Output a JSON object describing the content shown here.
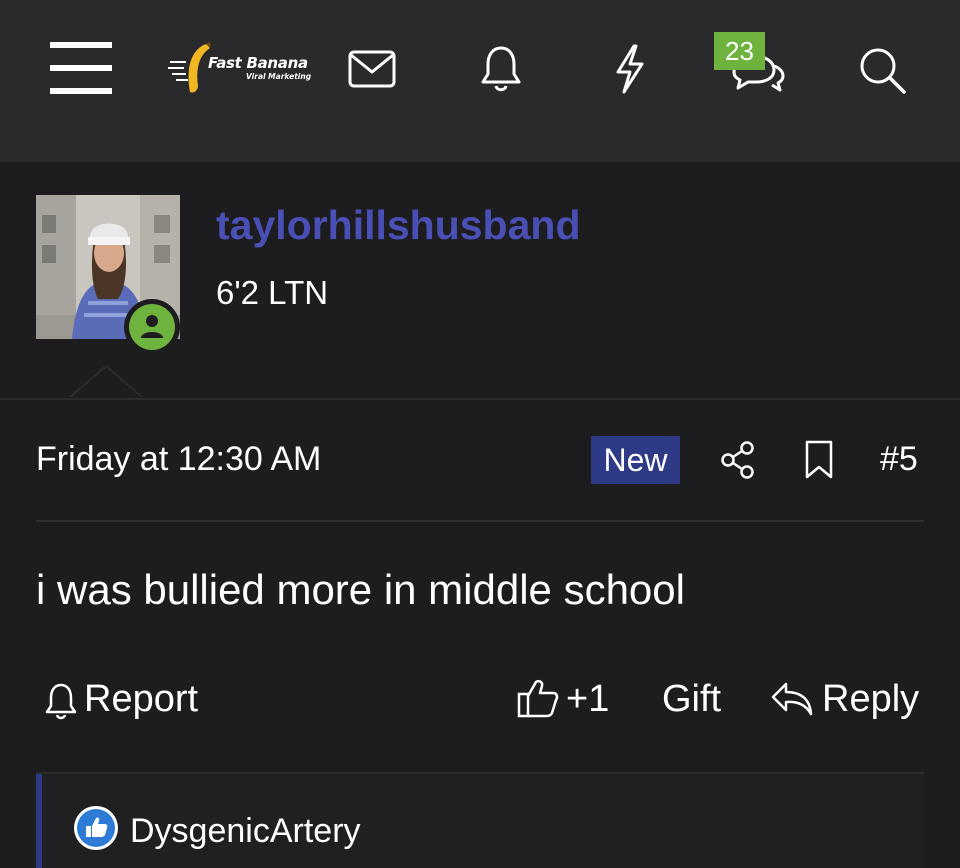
{
  "nav": {
    "logo_title": "Fast Banana",
    "logo_subtitle": "Viral Marketing",
    "conversations_badge": "23",
    "icons": [
      "menu-icon",
      "mail-icon",
      "bell-icon",
      "lightning-icon",
      "chat-bubbles-icon",
      "search-icon"
    ]
  },
  "profile": {
    "username": "taylorhillshusband",
    "user_title": "6'2 LTN",
    "status": "online"
  },
  "post": {
    "date": "Friday at 12:30 AM",
    "new_label": "New",
    "number": "#5",
    "body": "i was bullied more in middle school"
  },
  "actions": {
    "report_label": "Report",
    "like_label": "+1",
    "gift_label": "Gift",
    "reply_label": "Reply"
  },
  "reactions": {
    "user": "DysgenicArtery"
  },
  "colors": {
    "username": "#4a4fb5",
    "new_badge": "#2e3a86",
    "badge_green": "#6fb33f",
    "background": "#1d1d1f",
    "header": "#2a2a2c"
  }
}
